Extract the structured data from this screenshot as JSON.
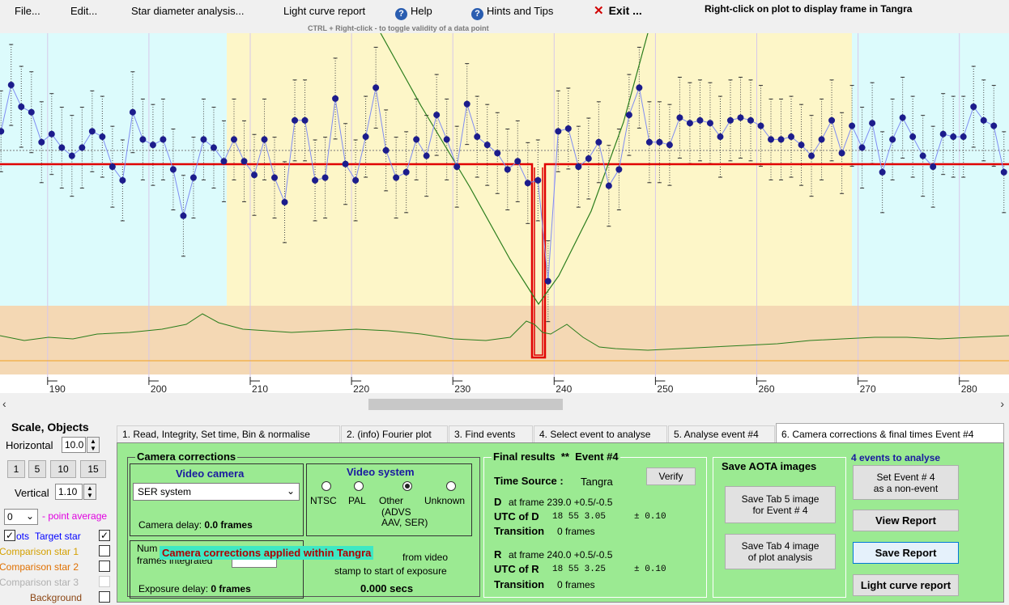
{
  "menu": {
    "file": "File...",
    "edit": "Edit...",
    "star_diameter": "Star diameter analysis...",
    "light_curve_report": "Light curve report",
    "help": "Help",
    "hints": "Hints and Tips",
    "exit_symbol": "✕",
    "exit": "Exit ...",
    "right_click_hint": "Right-click on plot to display frame in Tangra",
    "help_icon_glyph": "?"
  },
  "plot": {
    "ctrl_hint": "CTRL + Right-click  -  to toggle validity of a data point",
    "x_ticks": [
      "190",
      "200",
      "210",
      "220",
      "230",
      "240",
      "250",
      "260",
      "270",
      "280"
    ]
  },
  "chart_data": {
    "type": "line",
    "title": "",
    "xlabel": "",
    "ylabel": "",
    "xlim": [
      185.3,
      284.9
    ],
    "ylim": [
      0,
      1
    ],
    "grid": true,
    "x_ticks": [
      190,
      200,
      210,
      220,
      230,
      240,
      250,
      260,
      270,
      280
    ],
    "series": [
      {
        "x": [
          185.4,
          186.4,
          187.4,
          188.4,
          189.4,
          190.4,
          191.4,
          192.4,
          193.4,
          194.4,
          195.4,
          196.4,
          197.4,
          198.4,
          199.4,
          200.4,
          201.4,
          202.4,
          203.4,
          204.4,
          205.4,
          206.4,
          207.4,
          208.4,
          209.4,
          210.4,
          211.4,
          212.4,
          213.4,
          214.4,
          215.4,
          216.4,
          217.4,
          218.4,
          219.4,
          220.4,
          221.4,
          222.4,
          223.4,
          224.4,
          225.4,
          226.4,
          227.4,
          228.4,
          229.4,
          230.4,
          231.4,
          232.4,
          233.4,
          234.4,
          235.4,
          236.4,
          237.4,
          238.4,
          239.4,
          240.4,
          241.4,
          242.4,
          243.4,
          244.4,
          245.4,
          246.4,
          247.4,
          248.4,
          249.4,
          250.4,
          251.4,
          252.4,
          253.4,
          254.4,
          255.4,
          256.4,
          257.4,
          258.4,
          259.4,
          260.4,
          261.4,
          262.4,
          263.4,
          264.4,
          265.4,
          266.4,
          267.4,
          268.4,
          269.4,
          270.4,
          271.4,
          272.4,
          273.4,
          274.4,
          275.4,
          276.4,
          277.4,
          278.4,
          279.4,
          280.4,
          281.4,
          282.4,
          283.4,
          284.4
        ],
        "values": [
          0.64,
          0.81,
          0.73,
          0.71,
          0.6,
          0.63,
          0.58,
          0.55,
          0.58,
          0.64,
          0.62,
          0.51,
          0.46,
          0.71,
          0.61,
          0.59,
          0.61,
          0.5,
          0.33,
          0.47,
          0.61,
          0.58,
          0.53,
          0.61,
          0.53,
          0.48,
          0.61,
          0.47,
          0.38,
          0.68,
          0.68,
          0.46,
          0.47,
          0.76,
          0.52,
          0.46,
          0.62,
          0.8,
          0.57,
          0.47,
          0.49,
          0.61,
          0.55,
          0.7,
          0.61,
          0.51,
          0.74,
          0.62,
          0.59,
          0.56,
          0.5,
          0.53,
          0.45,
          0.46,
          0.09,
          0.64,
          0.65,
          0.51,
          0.54,
          0.6,
          0.44,
          0.5,
          0.7,
          0.8,
          0.6,
          0.6,
          0.59,
          0.69,
          0.67,
          0.68,
          0.67,
          0.62,
          0.68,
          0.69,
          0.68,
          0.66,
          0.61,
          0.61,
          0.62,
          0.59,
          0.55,
          0.61,
          0.68,
          0.56,
          0.66,
          0.58,
          0.67,
          0.49,
          0.61,
          0.69,
          0.62,
          0.55,
          0.51,
          0.63,
          0.62,
          0.62,
          0.73,
          0.68,
          0.66,
          0.49
        ]
      }
    ]
  },
  "scrollbar": {
    "left_glyph": "‹",
    "right_glyph": "›"
  },
  "left": {
    "title": "Scale,  Objects",
    "horizontal_label": "Horizontal",
    "horizontal_value": "10.0",
    "spin_up": "▲",
    "spin_down": "▼",
    "presets": [
      "1",
      "5",
      "10",
      "15"
    ],
    "vertical_label": "Vertical",
    "vertical_value": "1.10",
    "point_avg_value": "0",
    "point_avg_arrow": "⌄",
    "point_avg_label": "- point average",
    "dots_label": "ots",
    "target_label": "Target star",
    "comp1_label": "Comparison star 1",
    "comp2_label": "Comparison star 2",
    "comp3_label": "Comparison star 3",
    "background_label": "Background",
    "check_glyph": "✓",
    "colors": {
      "target": "#0000ff",
      "comp1": "#d4a000",
      "comp2": "#e07000",
      "comp3": "#b0b0b0",
      "background": "#8b4513"
    }
  },
  "tabs": [
    "1.  Read, Integrity, Set time, Bin & normalise",
    "2. (info)  Fourier plot",
    "3. Find events",
    "4. Select event to analyse",
    "5. Analyse event #4",
    "6. Camera corrections & final times Event #4"
  ],
  "camera": {
    "group_title": "Camera corrections",
    "video_camera_title": "Video camera",
    "camera_select": "SER system",
    "select_arrow": "⌄",
    "camera_delay_label": "Camera delay:",
    "camera_delay_value": "0.0 frames",
    "video_system_title": "Video system",
    "radio_ntsc": "NTSC",
    "radio_pal": "PAL",
    "radio_other": "Other",
    "radio_other_detail1": "(ADVS",
    "radio_other_detail2": "AAV, SER)",
    "radio_unknown": "Unknown",
    "num_frames_label1": "Num",
    "num_frames_label2": "frames integrated",
    "exposure_delay_label": "Exposure delay:",
    "exposure_delay_value": "0 frames",
    "from_video_label": "from video",
    "stamp_label": "stamp to start of exposure",
    "secs_value": "0.000 secs",
    "overlay_text": "Camera corrections applied within Tangra"
  },
  "results": {
    "title": "Final results",
    "stars": "**",
    "event": "Event #4",
    "verify_button": "Verify",
    "time_source_label": "Time Source :",
    "time_source_value": "Tangra",
    "d_label": "D",
    "d_frame": "at frame 239.0  +0.5/-0.5",
    "utc_d_label": "UTC of D",
    "utc_d_value": "18 55  3.05",
    "utc_d_err": "± 0.10",
    "d_transition_label": "Transition",
    "d_transition_value": "0 frames",
    "r_label": "R",
    "r_frame": "at frame 240.0  +0.5/-0.5",
    "utc_r_label": "UTC of R",
    "utc_r_value": "18 55  3.25",
    "utc_r_err": "± 0.10",
    "r_transition_label": "Transition",
    "r_transition_value": "0 frames"
  },
  "aota": {
    "title": "Save AOTA images",
    "save_tab5_line1": "Save Tab 5 image",
    "save_tab5_line2": "for Event # 4",
    "save_tab4_line1": "Save Tab 4 image",
    "save_tab4_line2": "of plot analysis"
  },
  "events": {
    "title": "4  events to analyse",
    "set_non_event_line1": "Set Event # 4",
    "set_non_event_line2": "as a non-event",
    "view_report": "View Report",
    "save_report": "Save Report",
    "light_curve_report": "Light curve report"
  }
}
